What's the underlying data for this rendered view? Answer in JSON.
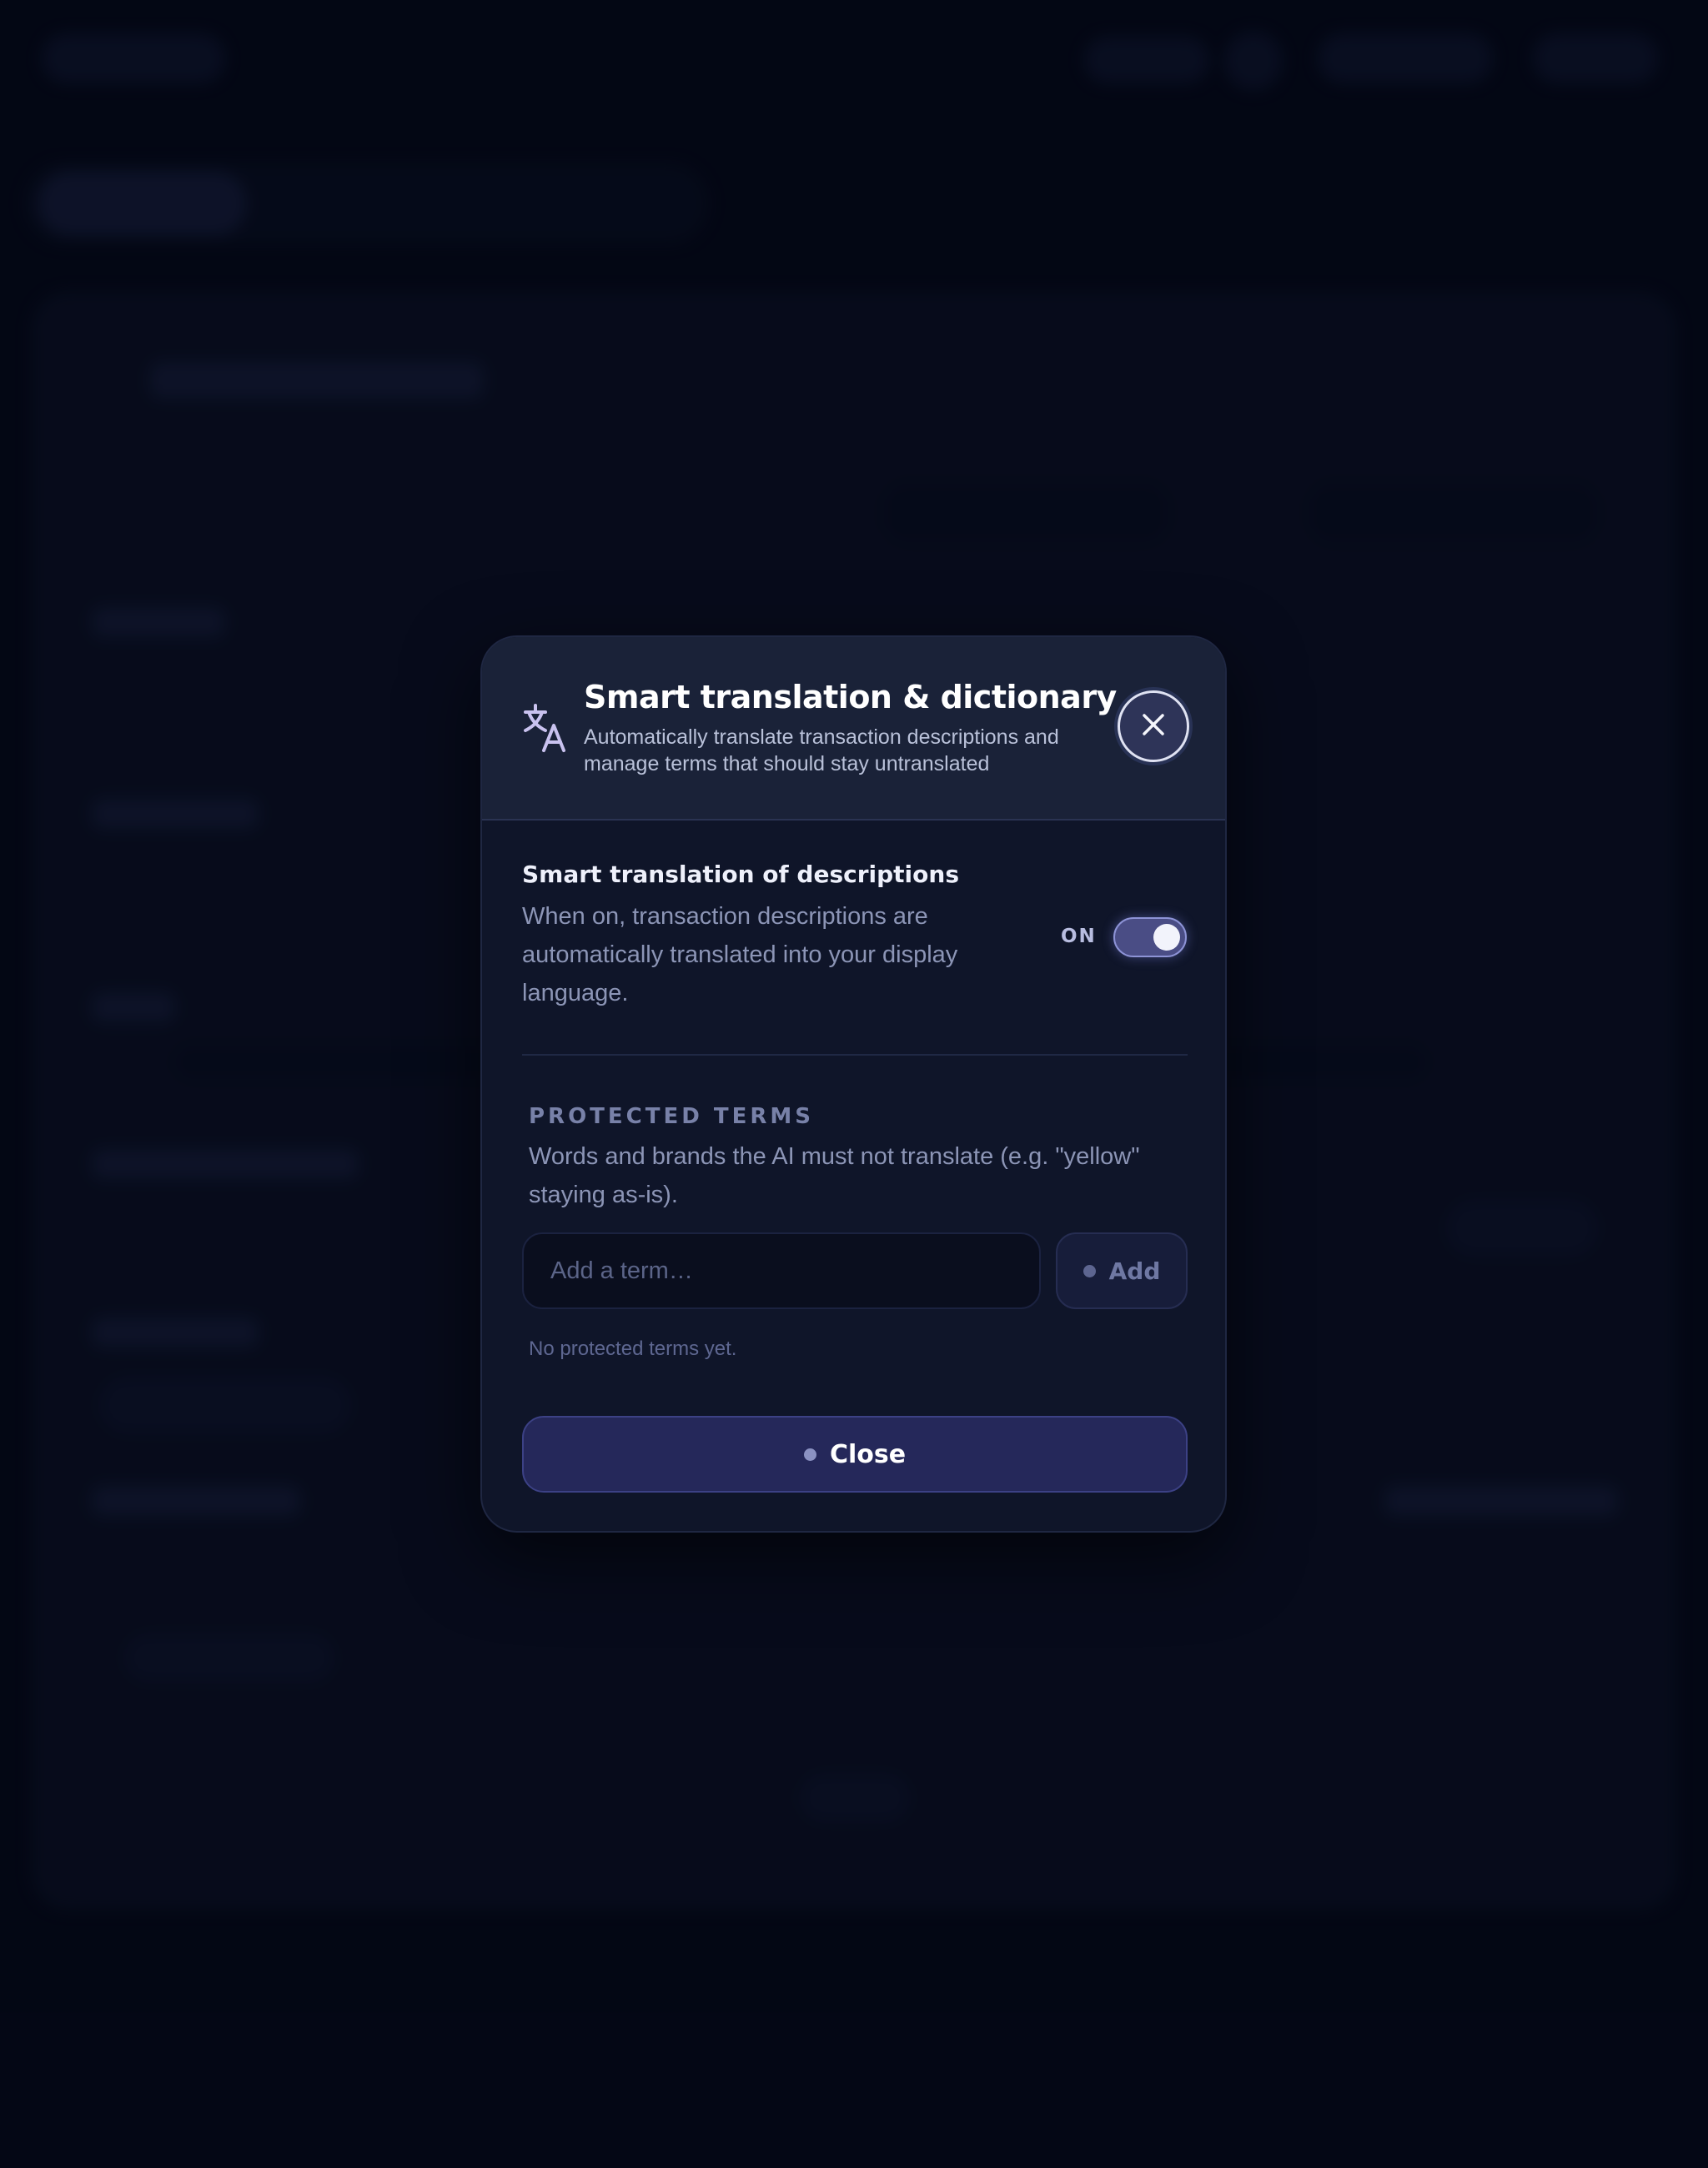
{
  "dialog": {
    "title": "Smart translation & dictionary",
    "subtitle": "Automatically translate transaction descriptions and manage terms that should stay untranslated",
    "header_icon": "translate-icon",
    "close_icon": "close-icon"
  },
  "translation_setting": {
    "title": "Smart translation of descriptions",
    "description": "When on, transaction descriptions are automatically translated into your display language.",
    "state_label": "ON",
    "enabled": true
  },
  "protected_terms": {
    "heading": "PROTECTED TERMS",
    "description": "Words and brands the AI must not translate (e.g. \"yellow\" staying as-is).",
    "input_placeholder": "Add a term…",
    "add_label": "Add",
    "empty_message": "No protected terms yet."
  },
  "footer": {
    "close_label": "Close"
  },
  "colors": {
    "background": "#050817",
    "modal": "#0f1529",
    "header": "#1a2238",
    "accent": "#4a4d85",
    "close_button": "#25285a"
  }
}
